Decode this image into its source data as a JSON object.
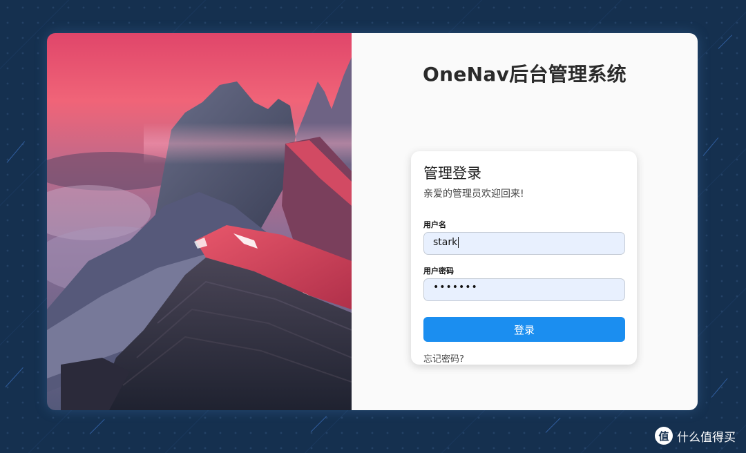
{
  "header": {
    "site_title": "OneNav后台管理系统"
  },
  "login": {
    "heading": "管理登录",
    "subtitle": "亲爱的管理员欢迎回来!",
    "username_label": "用户名",
    "username_value": "stark",
    "password_label": "用户密码",
    "password_value": "•••••••",
    "submit_label": "登录",
    "forgot_label": "忘记密码?"
  },
  "watermark": {
    "text": "什么值得买",
    "logo_glyph": "值"
  },
  "colors": {
    "background": "#15304f",
    "panel": "#fafafa",
    "input_bg": "#e8f0fe",
    "button": "#1b8ef0"
  },
  "icons": {
    "hero_image": "mountain-landscape",
    "watermark_logo": "smzdm-logo-icon"
  }
}
